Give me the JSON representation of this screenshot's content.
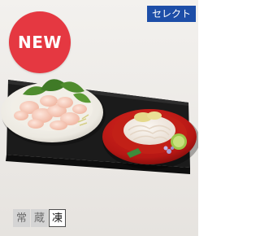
{
  "badges": {
    "new_label": "NEW",
    "select_label": "セレクト"
  },
  "storage": {
    "items": [
      {
        "label": "常",
        "active": false
      },
      {
        "label": "蔵",
        "active": false
      },
      {
        "label": "凍",
        "active": true
      }
    ]
  },
  "colors": {
    "new_badge": "#e53841",
    "select_tag": "#1d4ea8",
    "tray": "#1c1c1c",
    "red_plate": "#c81d1a"
  },
  "image": {
    "icon": "food-product-photo"
  }
}
